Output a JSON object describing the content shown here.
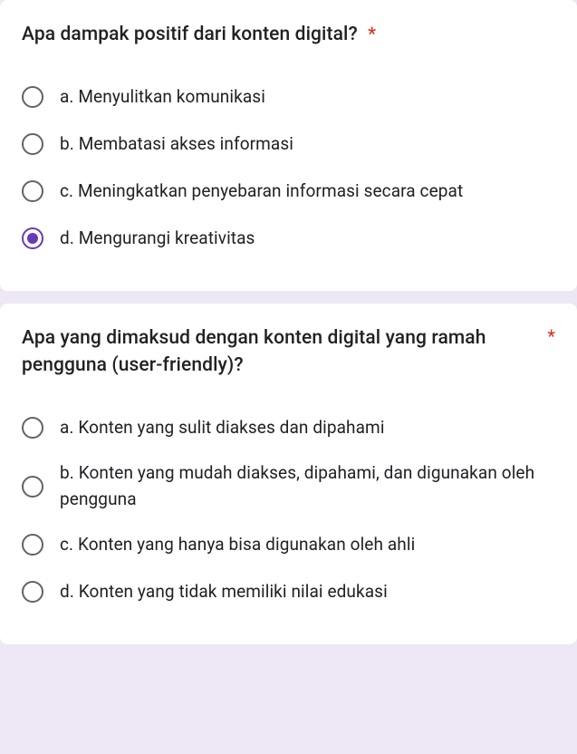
{
  "required_marker": "*",
  "questions": [
    {
      "title": "Apa dampak positif dari konten digital?",
      "required": true,
      "selected": 3,
      "options": [
        "a. Menyulitkan komunikasi",
        "b. Membatasi akses informasi",
        "c. Meningkatkan penyebaran informasi secara cepat",
        "d. Mengurangi kreativitas"
      ]
    },
    {
      "title": "Apa yang dimaksud dengan konten digital yang ramah pengguna (user-friendly)?",
      "required": true,
      "selected": -1,
      "options": [
        "a. Konten yang sulit diakses dan dipahami",
        "b. Konten yang mudah diakses, dipahami, dan digunakan oleh pengguna",
        "c. Konten yang hanya bisa digunakan oleh ahli",
        "d. Konten yang tidak memiliki nilai edukasi"
      ]
    }
  ]
}
